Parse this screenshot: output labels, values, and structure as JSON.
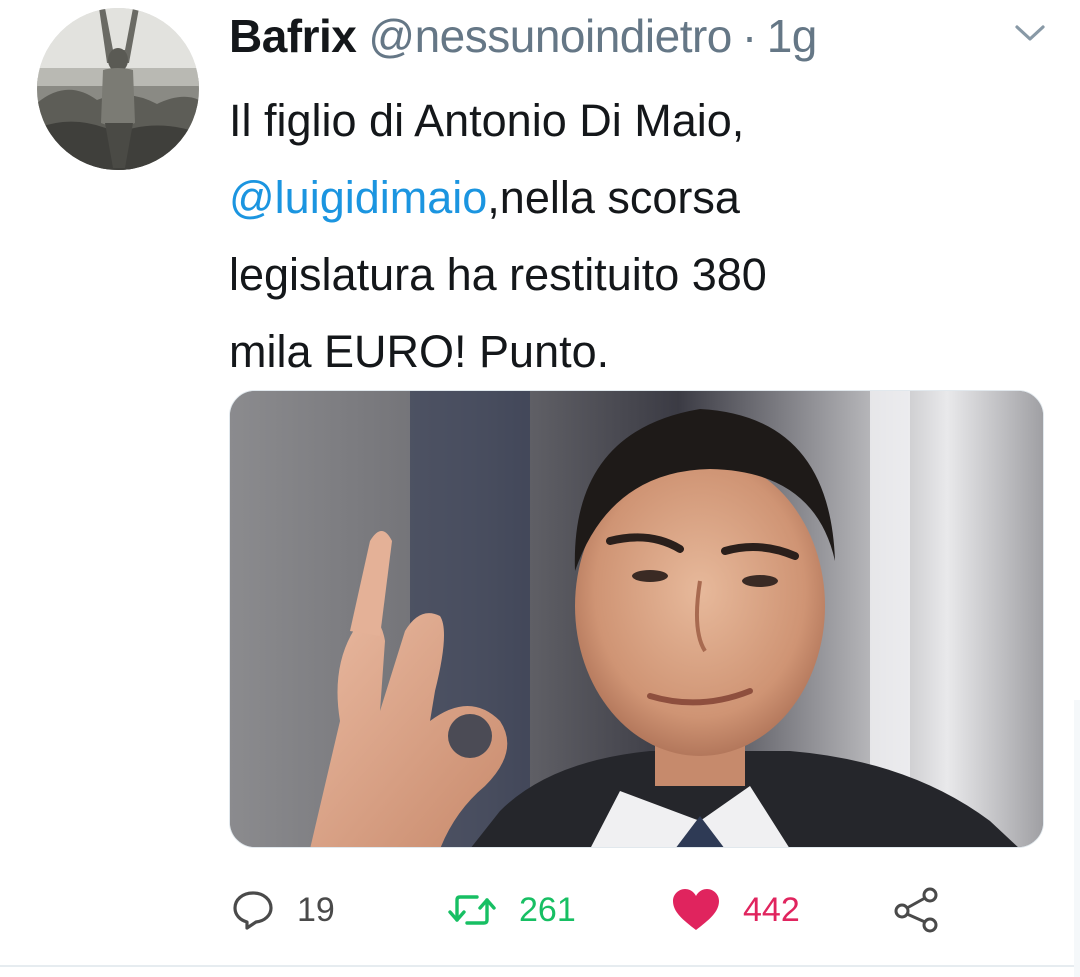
{
  "tweet": {
    "display_name": "Bafrix",
    "handle": "@nessunoindietro",
    "separator": "·",
    "time": "1g",
    "text_lines": {
      "line1": "Il figlio di Antonio Di Maio,",
      "mention": "@luigidimaio",
      "line2_rest": ",nella scorsa",
      "line3": "legislatura ha restituito 380",
      "line4": "mila EURO! Punto."
    },
    "actions": {
      "replies": "19",
      "retweets": "261",
      "likes": "442"
    }
  },
  "icons": {
    "caret": "chevron-down-icon",
    "reply": "speech-bubble-icon",
    "retweet": "retweet-arrows-icon",
    "like": "heart-icon",
    "share": "share-nodes-icon"
  },
  "colors": {
    "text": "#14171a",
    "muted": "#657786",
    "link": "#1b95e0",
    "retweet": "#17bf63",
    "like": "#e0245e"
  }
}
